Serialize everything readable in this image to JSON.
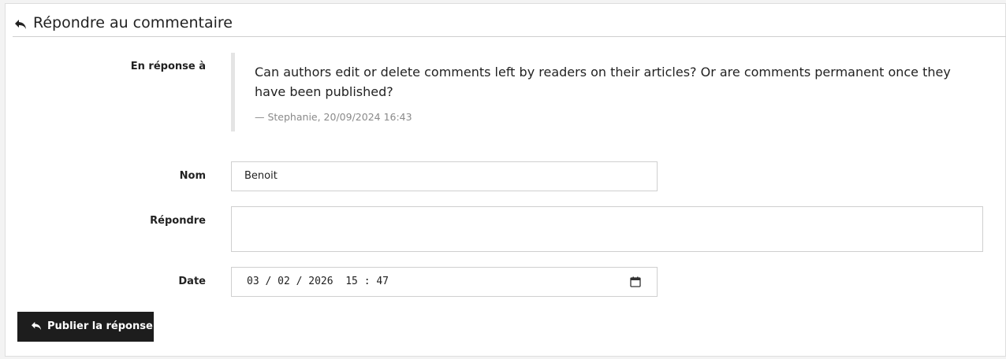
{
  "header": {
    "title": "Répondre au commentaire",
    "icon": "reply-icon"
  },
  "in_reply_to": {
    "label": "En réponse à",
    "comment_text": "Can authors edit or delete comments left by readers on their articles? Or are comments permanent once they have been published?",
    "comment_meta": "— Stephanie, 20/09/2024 16:43"
  },
  "form": {
    "name_label": "Nom",
    "name_value": "Benoit",
    "reply_label": "Répondre",
    "reply_value": "",
    "date_label": "Date",
    "date_value": "03 / 02 / 2026  15 : 47",
    "date_icon": "calendar-icon"
  },
  "submit": {
    "label": "Publier la réponse",
    "icon": "reply-icon"
  },
  "colors": {
    "button_bg": "#1d1d1d",
    "quote_border": "#e4e4e4",
    "meta_text": "#8a8a8a"
  }
}
